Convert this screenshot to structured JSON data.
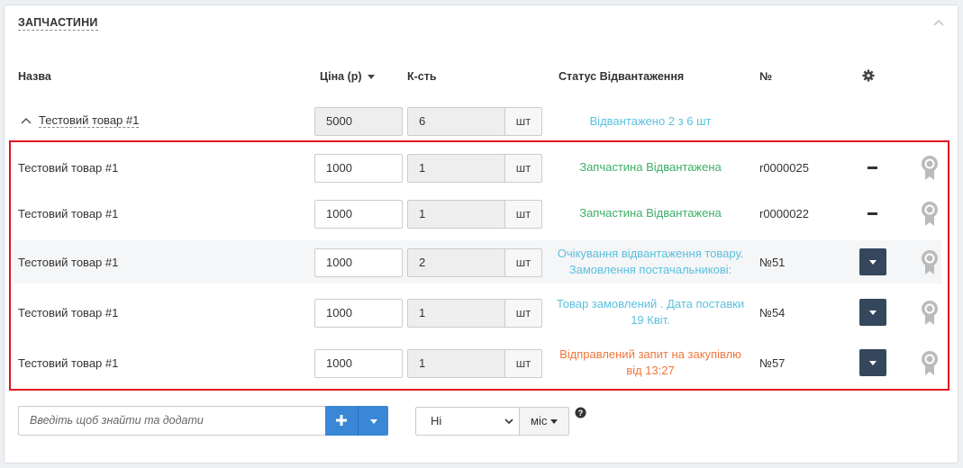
{
  "panel": {
    "title": "ЗАПЧАСТИНИ"
  },
  "headers": {
    "name": "Назва",
    "price": "Ціна (р)",
    "qty": "К-сть",
    "status": "Статус Відвантаження",
    "number": "№"
  },
  "group": {
    "name": "Тестовий товар #1",
    "price": "5000",
    "qty": "6",
    "unit": "шт",
    "status": "Відвантажено 2 з 6 шт"
  },
  "rows": [
    {
      "name": "Тестовий товар #1",
      "price": "1000",
      "qty": "1",
      "unit": "шт",
      "status_line1": "Запчастина Відвантажена",
      "status_line2": "",
      "number": "r0000025",
      "action": "minus"
    },
    {
      "name": "Тестовий товар #1",
      "price": "1000",
      "qty": "1",
      "unit": "шт",
      "status_line1": "Запчастина Відвантажена",
      "status_line2": "",
      "number": "r0000022",
      "action": "minus"
    },
    {
      "name": "Тестовий товар #1",
      "price": "1000",
      "qty": "2",
      "unit": "шт",
      "status_line1": "Очікування відвантаження товару.",
      "status_line2": "Замовлення постачальникові:",
      "number": "№51",
      "action": "dropdown"
    },
    {
      "name": "Тестовий товар #1",
      "price": "1000",
      "qty": "1",
      "unit": "шт",
      "status_line1": "Товар замовлений . Дата поставки",
      "status_line2": "19 Квіт.",
      "number": "№54",
      "action": "dropdown"
    },
    {
      "name": "Тестовий товар #1",
      "price": "1000",
      "qty": "1",
      "unit": "шт",
      "status_line1": "Відправлений запит на закупівлю",
      "status_line2": "від 13:27",
      "number": "№57",
      "action": "dropdown"
    }
  ],
  "footer": {
    "search_placeholder": "Введіть щоб знайти та додати",
    "select_value": "Ні",
    "mis_label": "міс"
  },
  "colors": {
    "status_blue": "#5bc0de",
    "status_green": "#3fae68",
    "status_orange": "#f0763b",
    "primary": "#3a87d6",
    "dark_btn": "#35475c",
    "highlight": "#e0141e"
  },
  "icons": {
    "collapse": "chevron-up-icon",
    "settings": "gear-icon",
    "row_badge": "award-icon",
    "add": "plus-icon",
    "help": "question-circle-icon"
  }
}
